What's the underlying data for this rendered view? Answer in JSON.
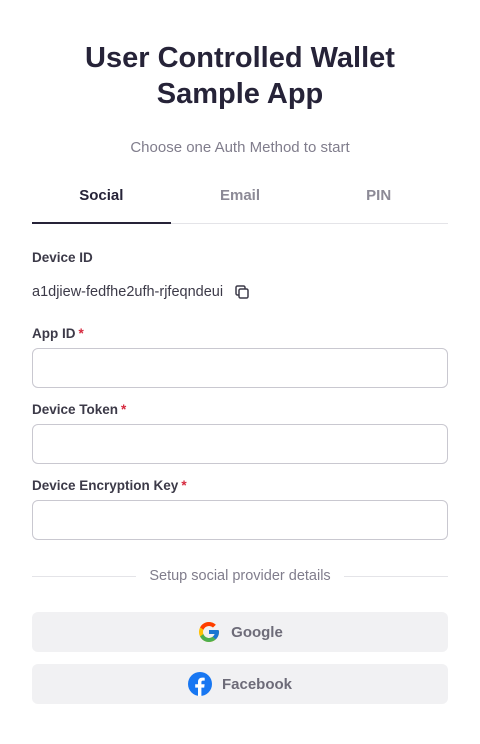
{
  "header": {
    "title_line1": "User Controlled Wallet",
    "title_line2": "Sample App",
    "subtitle": "Choose one Auth Method to start"
  },
  "tabs": [
    {
      "label": "Social",
      "active": true
    },
    {
      "label": "Email",
      "active": false
    },
    {
      "label": "PIN",
      "active": false
    }
  ],
  "device": {
    "label": "Device ID",
    "value": "a1djiew-fedfhe2ufh-rjfeqndeui"
  },
  "form": {
    "app_id_label": "App ID",
    "app_id_value": "",
    "device_token_label": "Device Token",
    "device_token_value": "",
    "encryption_key_label": "Device Encryption Key",
    "encryption_key_value": "",
    "required_marker": "*"
  },
  "social": {
    "divider_text": "Setup social provider details",
    "google_label": "Google",
    "facebook_label": "Facebook"
  },
  "icons": {
    "copy": "copy-icon",
    "google": "google-icon",
    "facebook": "facebook-icon"
  },
  "colors": {
    "title": "#262338",
    "required": "#d6293e",
    "facebook": "#1877f2",
    "button_bg": "#f1f1f3"
  }
}
